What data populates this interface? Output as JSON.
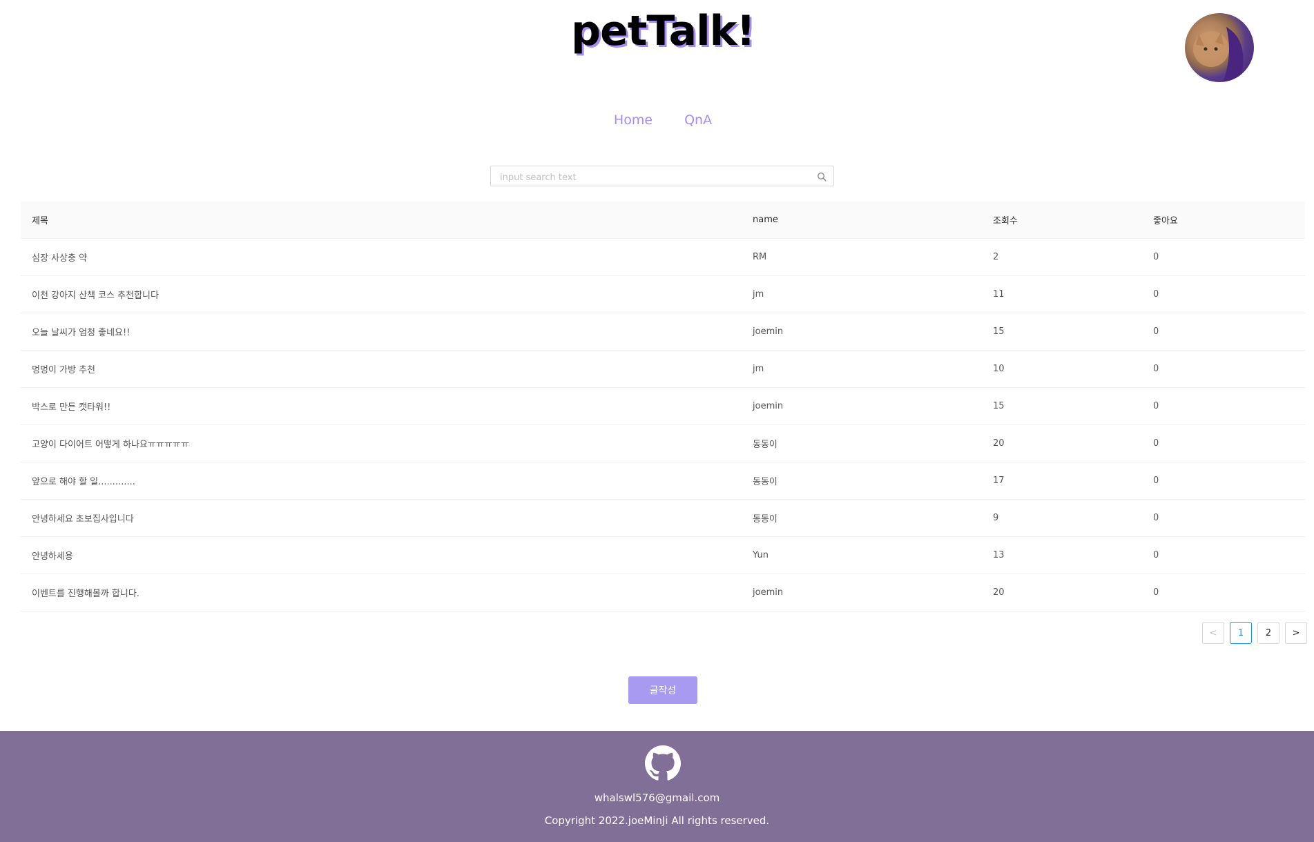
{
  "header": {
    "logo": "petTalk!"
  },
  "nav": {
    "home": "Home",
    "qna": "QnA"
  },
  "search": {
    "placeholder": "input search text"
  },
  "table": {
    "columns": {
      "title": "제목",
      "name": "name",
      "views": "조회수",
      "likes": "좋아요"
    },
    "rows": [
      {
        "title": "심장 사상충 약",
        "name": "RM",
        "views": "2",
        "likes": "0"
      },
      {
        "title": "이천 강아지 산책 코스 추천합니다",
        "name": "jm",
        "views": "11",
        "likes": "0"
      },
      {
        "title": "오늘 날씨가 엄청 좋네요!!",
        "name": "joemin",
        "views": "15",
        "likes": "0"
      },
      {
        "title": "멍멍이 가방 추천",
        "name": "jm",
        "views": "10",
        "likes": "0"
      },
      {
        "title": "박스로 만든 캣타워!!",
        "name": "joemin",
        "views": "15",
        "likes": "0"
      },
      {
        "title": "고양이 다이어트 어떻게 하나요ㅠㅠㅠㅠㅠ",
        "name": "동동이",
        "views": "20",
        "likes": "0"
      },
      {
        "title": "앞으로 해야 할 일.............",
        "name": "동동이",
        "views": "17",
        "likes": "0"
      },
      {
        "title": "안녕하세요 초보집사입니다",
        "name": "동동이",
        "views": "9",
        "likes": "0"
      },
      {
        "title": "안녕하세용",
        "name": "Yun",
        "views": "13",
        "likes": "0"
      },
      {
        "title": "이벤트를 진행해볼까 합니다.",
        "name": "joemin",
        "views": "20",
        "likes": "0"
      }
    ]
  },
  "pagination": {
    "prev": "<",
    "pages": [
      "1",
      "2"
    ],
    "current": "1",
    "next": ">"
  },
  "write_button": "글작성",
  "footer": {
    "icon": "github-icon",
    "email": "whalswl576@gmail.com",
    "copyright": "Copyright 2022.joeMinJi All rights reserved."
  },
  "colors": {
    "accent": "#a78bfa",
    "footer_bg": "#816f98",
    "button_bg": "#a89af0",
    "active_page": "#1890ff"
  }
}
